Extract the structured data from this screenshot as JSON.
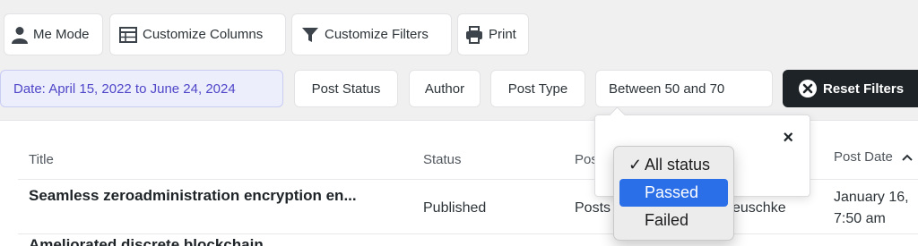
{
  "toolbar": {
    "me_mode": "Me Mode",
    "customize_columns": "Customize Columns",
    "customize_filters": "Customize Filters",
    "print": "Print"
  },
  "filters": {
    "date": "Date: April 15, 2022 to June 24, 2024",
    "post_status": "Post Status",
    "author": "Author",
    "post_type": "Post Type",
    "between": "Between 50 and 70",
    "reset": "Reset Filters"
  },
  "table": {
    "headers": {
      "title": "Title",
      "status": "Status",
      "post_type_partial": "Pos",
      "post_date": "Post Date"
    },
    "rows": [
      {
        "title": "Seamless zeroadministration encryption en...",
        "status": "Published",
        "post_type_partial": "Posts",
        "author_partial": "euschke",
        "date_line1": "January 16,",
        "date_line2": "7:50 am"
      },
      {
        "title": "Ameliorated discrete blockchain"
      }
    ]
  },
  "popover": {
    "close": "×"
  },
  "dropdown": {
    "options": [
      "All status",
      "Passed",
      "Failed"
    ],
    "checked_index": 0,
    "highlighted_index": 1,
    "check_glyph": "✓"
  },
  "icons": {
    "sort": "chevron-up-icon"
  },
  "colors": {
    "accent": "#4f46c8",
    "highlight": "#2a6ee8",
    "reset_bg": "#1d2327"
  }
}
